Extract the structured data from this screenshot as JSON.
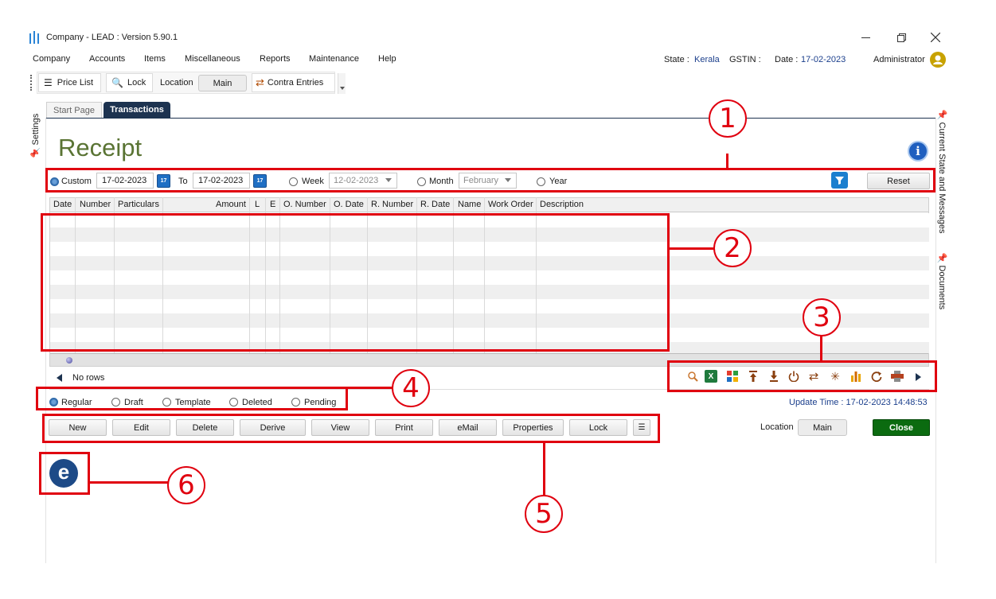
{
  "window": {
    "title": "Company - LEAD : Version 5.90.1"
  },
  "menu": [
    "Company",
    "Accounts",
    "Items",
    "Miscellaneous",
    "Reports",
    "Maintenance",
    "Help"
  ],
  "status": {
    "state_label": "State :",
    "state_value": "Kerala",
    "gstin_label": "GSTIN :",
    "date_label": "Date :",
    "date_value": "17-02-2023",
    "user": "Administrator"
  },
  "toolbar": {
    "price_list": "Price List",
    "lock": "Lock",
    "location_label": "Location",
    "location_value": "Main",
    "contra": "Contra Entries"
  },
  "tabs": [
    "Start Page",
    "Transactions"
  ],
  "side_panels": {
    "left": "Settings",
    "right_top": "Current State and Messages",
    "right_bottom": "Documents"
  },
  "page_title": "Receipt",
  "filter": {
    "custom": "Custom",
    "from_date": "17-02-2023",
    "to_label": "To",
    "to_date": "17-02-2023",
    "calendar_icon_text": "17",
    "week": "Week",
    "week_value": "12-02-2023",
    "month": "Month",
    "month_value": "February",
    "year": "Year",
    "reset": "Reset"
  },
  "table": {
    "columns": [
      "Date",
      "Number",
      "Particulars",
      "Amount",
      "L",
      "E",
      "O. Number",
      "O. Date",
      "R. Number",
      "R. Date",
      "Name",
      "Work Order",
      "Description"
    ],
    "rows": [],
    "empty_text": "No rows"
  },
  "status_radios": [
    "Regular",
    "Draft",
    "Template",
    "Deleted",
    "Pending"
  ],
  "update_time": "Update Time : 17-02-2023  14:48:53",
  "actions": [
    "New",
    "Edit",
    "Delete",
    "Derive",
    "View",
    "Print",
    "eMail",
    "Properties",
    "Lock"
  ],
  "bottom": {
    "location_label": "Location",
    "location_value": "Main",
    "close": "Close",
    "logo_letter": "e"
  },
  "callouts": [
    "1",
    "2",
    "3",
    "4",
    "5",
    "6"
  ],
  "colors": {
    "title_green": "#5a7434",
    "highlight_red": "#e0000f",
    "tab_dark": "#1d3350",
    "close_green": "#0b6b10",
    "state_blue": "#1b3f8c"
  }
}
